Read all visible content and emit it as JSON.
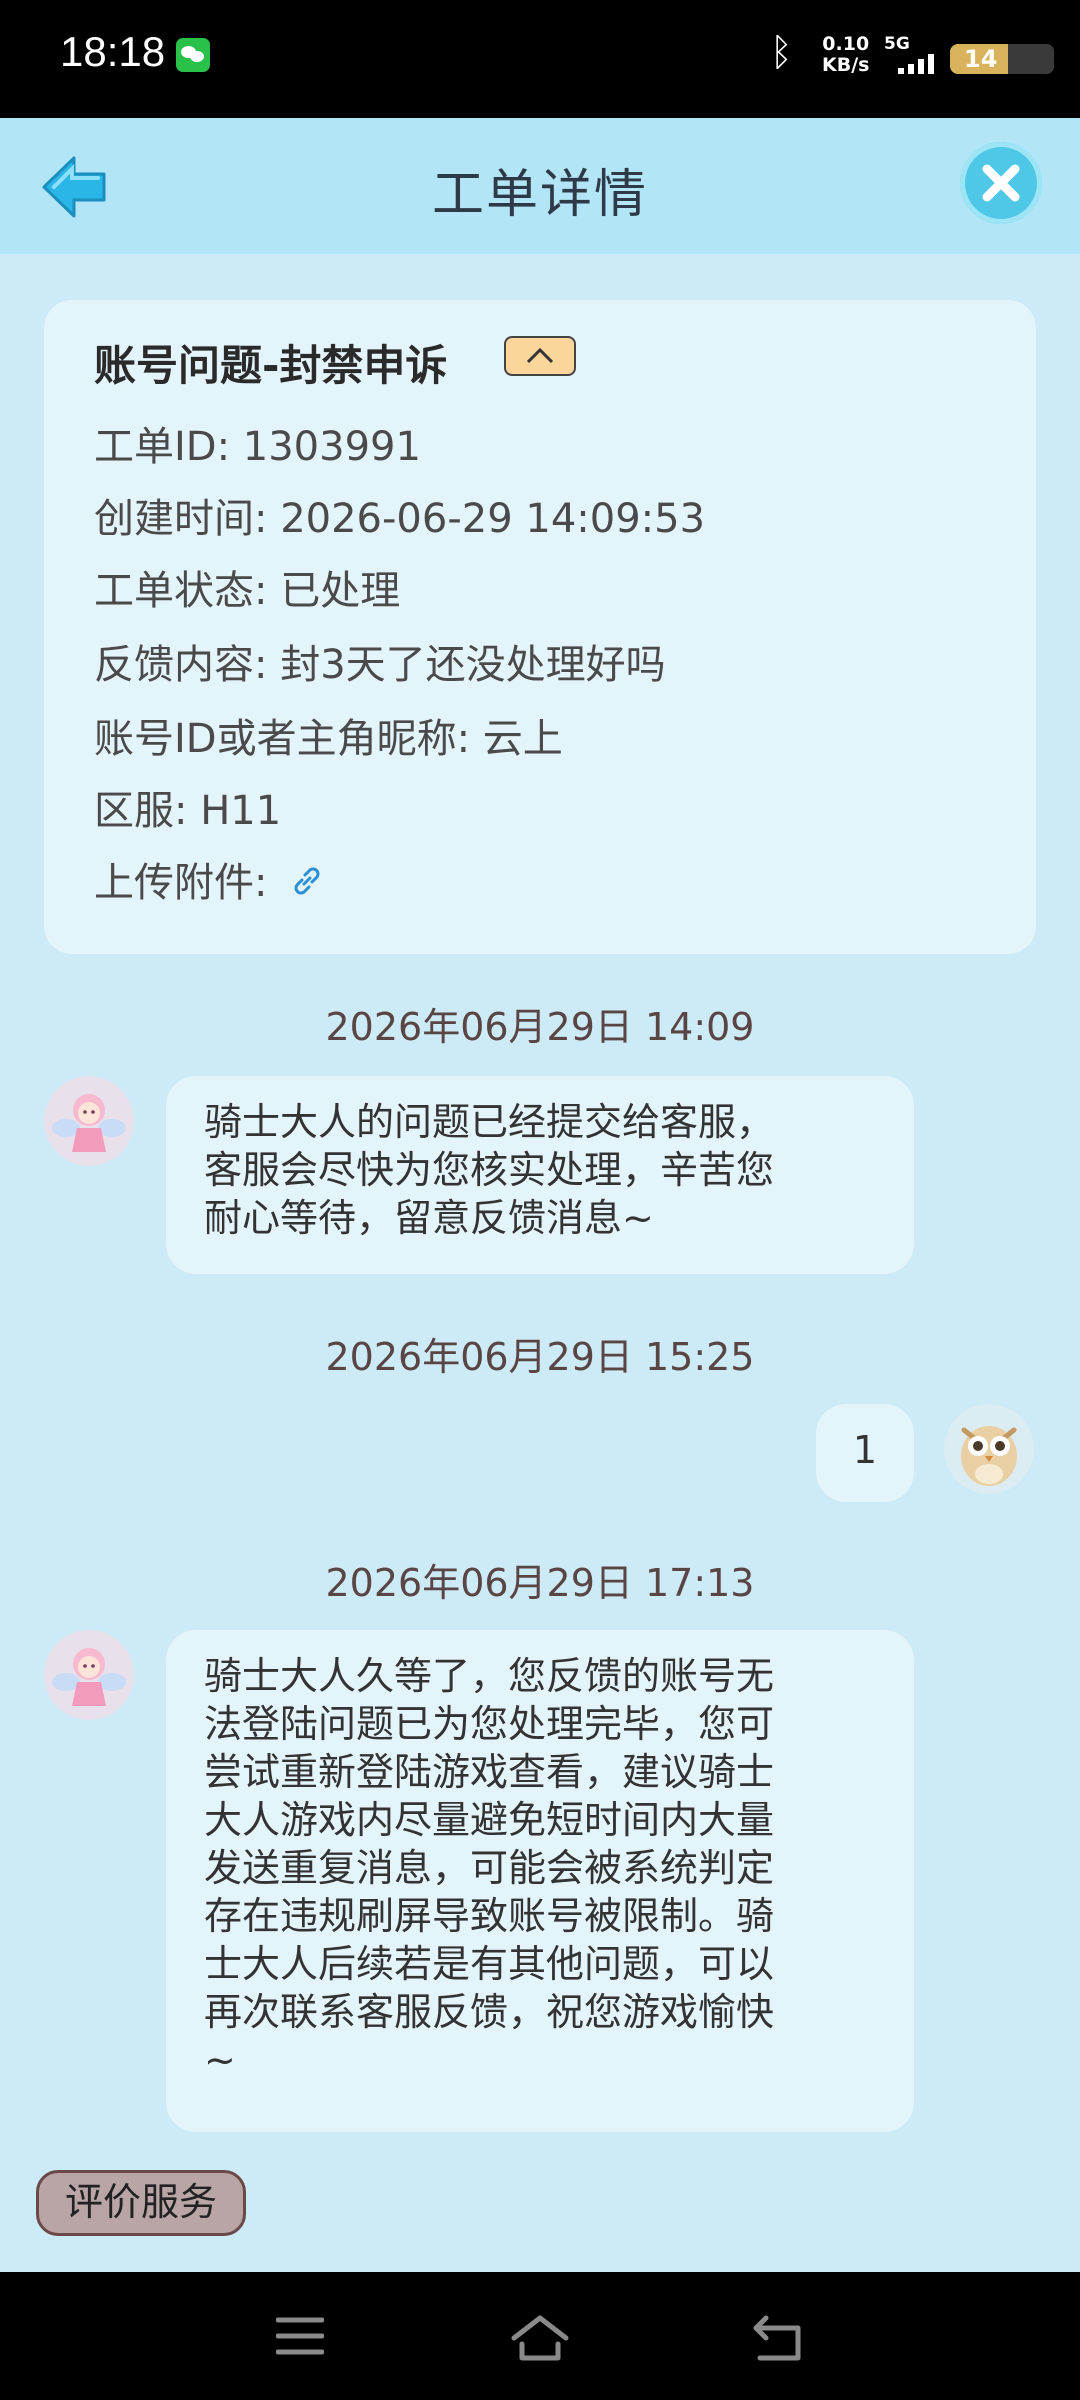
{
  "status_bar": {
    "time": "18:18",
    "speed_value": "0.10",
    "speed_unit": "KB/s",
    "network": "5G",
    "battery": "14",
    "icons": [
      "wechat-icon",
      "bluetooth-icon",
      "signal-icon",
      "battery-icon"
    ]
  },
  "header": {
    "title": "工单详情",
    "back_icon": "back-arrow-icon",
    "close_icon": "close-icon"
  },
  "ticket": {
    "title": "账号问题-封禁申诉",
    "rows": [
      "工单ID: 1303991",
      "创建时间: 2026-06-29 14:09:53",
      "工单状态: 已处理",
      "反馈内容: 封3天了还没处理好吗",
      "账号ID或者主角昵称: 云上",
      "区服: H11",
      "上传附件:"
    ],
    "attachment_icon": "link-icon"
  },
  "messages": [
    {
      "timestamp": "2026年06月29日 14:09",
      "sender": "service",
      "lines": [
        "骑士大人的问题已经提交给客服，",
        "客服会尽快为您核实处理，辛苦您",
        "耐心等待，留意反馈消息~"
      ]
    },
    {
      "timestamp": "2026年06月29日 15:25",
      "sender": "user",
      "lines": [
        "1"
      ]
    },
    {
      "timestamp": "2026年06月29日 17:13",
      "sender": "service",
      "lines": [
        "骑士大人久等了，您反馈的账号无",
        "法登陆问题已为您处理完毕，您可",
        "尝试重新登陆游戏查看，建议骑士",
        "大人游戏内尽量避免短时间内大量",
        "发送重复消息，可能会被系统判定",
        "存在违规刷屏导致账号被限制。骑",
        "士大人后续若是有其他问题，可以",
        "再次联系客服反馈，祝您游戏愉快",
        "~"
      ]
    }
  ],
  "rate_button": "评价服务",
  "nav": [
    "menu-icon",
    "home-icon",
    "back-icon"
  ]
}
